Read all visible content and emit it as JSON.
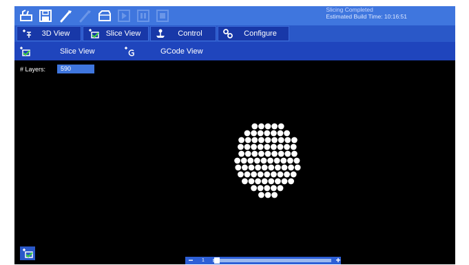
{
  "window": {
    "status_line1": "Slicing Completed",
    "status_line2": "Estimated Build Time: 10:16:51"
  },
  "toolbar": {
    "buttons": [
      {
        "icon": "print-icon",
        "enabled": true
      },
      {
        "icon": "save-icon",
        "enabled": true
      },
      {
        "icon": "wand-icon",
        "enabled": true
      },
      {
        "icon": "wand-disabled-icon",
        "enabled": false
      },
      {
        "icon": "folder-icon",
        "enabled": true
      },
      {
        "icon": "play-icon",
        "enabled": false
      },
      {
        "icon": "pause-icon",
        "enabled": false
      },
      {
        "icon": "stop-icon",
        "enabled": false
      }
    ]
  },
  "tabs": [
    {
      "label": "3D View",
      "icon": "3d-view-icon"
    },
    {
      "label": "Slice View",
      "icon": "slice-view-icon"
    },
    {
      "label": "Control",
      "icon": "control-joystick-icon"
    },
    {
      "label": "Configure",
      "icon": "configure-icon"
    }
  ],
  "subtabs": [
    {
      "label": "Slice View",
      "icon": "slice-view-icon"
    },
    {
      "label": "GCode View",
      "icon": "gcode-view-icon"
    }
  ],
  "viewport": {
    "layers_label": "# Layers:",
    "layers_value": "590",
    "background": "#000000",
    "dot_color": "#ffffff",
    "slice_dots_per_row": [
      5,
      7,
      9,
      9,
      9,
      10,
      10,
      9,
      8,
      5,
      3
    ]
  },
  "slider": {
    "minus": "−",
    "plus": "+",
    "value": "1",
    "position_fraction": 0.0
  },
  "colors": {
    "toolbar": "#3f76de",
    "tabs_bar": "#2a58c8",
    "tab": "#1838a8",
    "subtabs_bar": "#1f45bd"
  }
}
